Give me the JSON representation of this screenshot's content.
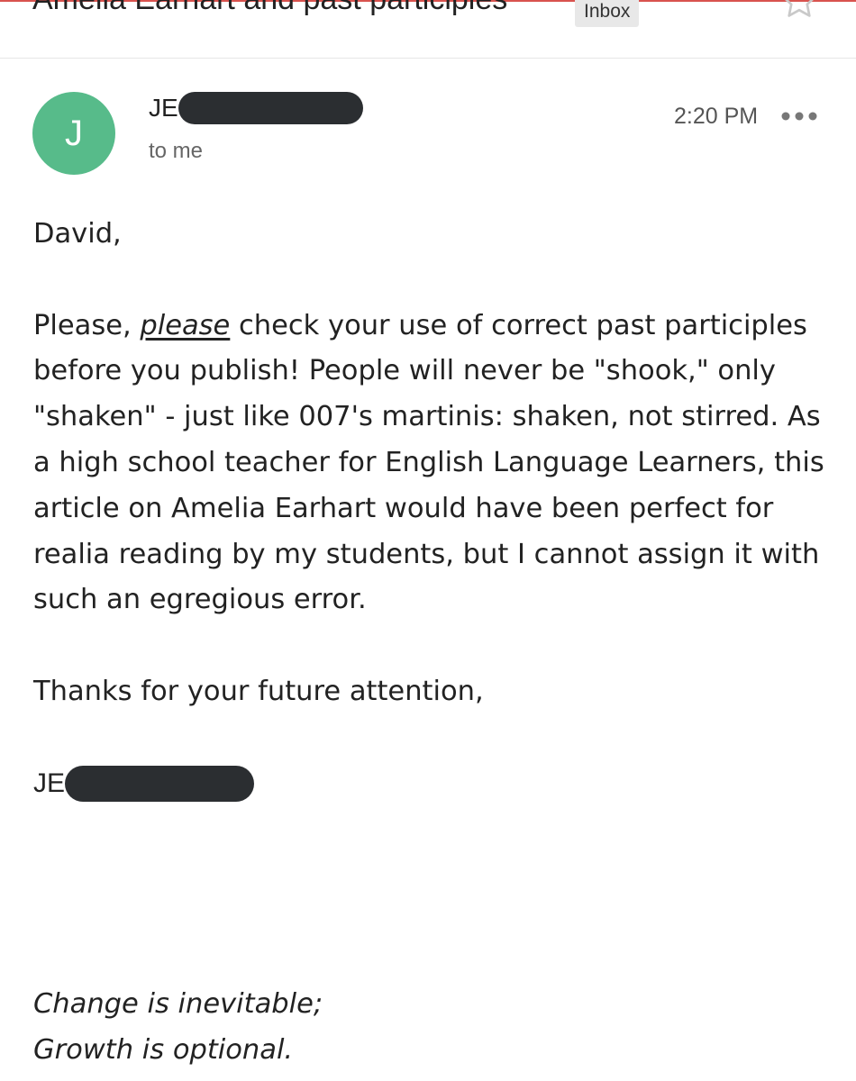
{
  "email": {
    "subject": "Amelia Earhart and past participles",
    "label": "Inbox",
    "sender": {
      "avatar_letter": "J",
      "name_prefix": "JE",
      "recipient_text": "to me"
    },
    "time": "2:20 PM"
  },
  "body": {
    "greeting": "David,",
    "p1_start": "Please, ",
    "p1_emphasis": "please",
    "p1_rest": " check your use of correct past participles before you publish! People will never be \"shook,\" only \"shaken\" - just like 007's martinis: shaken, not stirred. As a high school teacher for English Language Learners, this article on Amelia Earhart would have been perfect for realia reading by my students, but I cannot assign it with such an egregious error.",
    "closing": "Thanks for your future attention,",
    "signature_prefix": "JE",
    "quote_line1": "Change is inevitable;",
    "quote_line2": "Growth is optional."
  },
  "colors": {
    "avatar": "#57bb8a",
    "redaction": "#2b2e31",
    "accent": "#d9534f"
  },
  "icons": [
    "star-icon",
    "more-options-icon"
  ]
}
